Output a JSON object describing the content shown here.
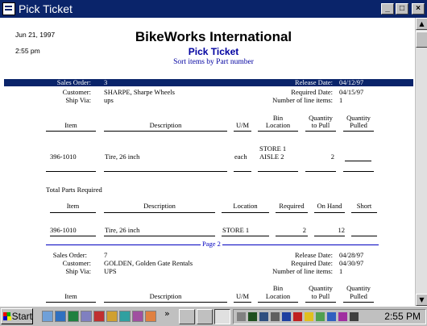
{
  "window": {
    "title": "Pick Ticket",
    "min_label": "_",
    "max_label": "□",
    "close_label": "×"
  },
  "report": {
    "date": "Jun 21, 1997",
    "time": "2:55 pm",
    "company": "BikeWorks International",
    "title": "Pick Ticket",
    "subtitle": "Sort items by Part number",
    "labels": {
      "sales_order": "Sales Order:",
      "customer": "Customer:",
      "ship_via": "Ship Via:",
      "release_date": "Release Date:",
      "required_date": "Required Date:",
      "line_items": "Number of line items:",
      "col_item": "Item",
      "col_desc": "Description",
      "col_um": "U/M",
      "col_bin": "Bin",
      "col_location": "Location",
      "col_qty": "Quantity",
      "col_to_pull": "to Pull",
      "col_pulled": "Pulled",
      "total_parts": "Total Parts Required",
      "col_required": "Required",
      "col_on_hand": "On Hand",
      "col_short": "Short",
      "page_break": "Page 2"
    },
    "order1": {
      "sales_order": "3",
      "customer": "SHARPE, Sharpe Wheels",
      "ship_via": "ups",
      "release_date": "04/12/97",
      "required_date": "04/15/97",
      "line_items": "1",
      "line": {
        "item": "396-1010",
        "description": "Tire, 26 inch",
        "um": "each",
        "bin1": "STORE 1",
        "bin2": "AISLE 2",
        "to_pull": "2"
      },
      "total": {
        "item": "396-1010",
        "description": "Tire, 26 inch",
        "location": "STORE 1",
        "required": "2",
        "on_hand": "12"
      }
    },
    "order2": {
      "sales_order": "7",
      "customer": "GOLDEN, Golden Gate Rentals",
      "ship_via": "UPS",
      "release_date": "04/28/97",
      "required_date": "04/30/97",
      "line_items": "1"
    }
  },
  "taskbar": {
    "start_label": "Start",
    "clock": "2:55 PM",
    "more_label": "»"
  },
  "colors": {
    "titlebar": "#0a246a",
    "accent_text": "#0000a0",
    "desktop": "#c0c0c0"
  }
}
